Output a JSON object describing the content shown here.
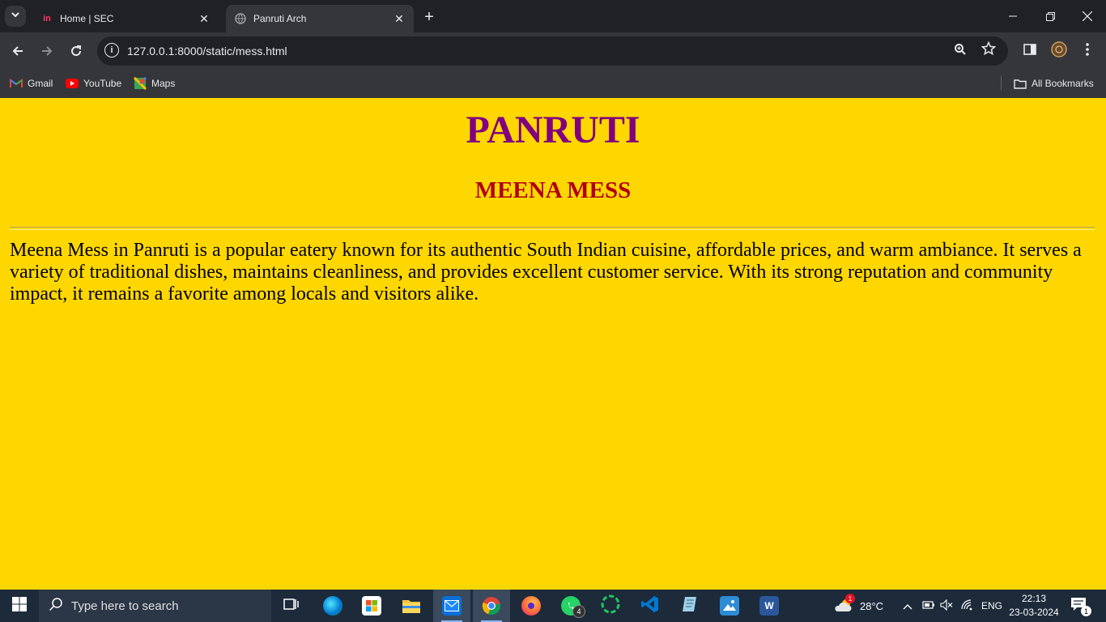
{
  "browser": {
    "tabs": [
      {
        "title": "Home | SEC",
        "favicon": "invision-icon"
      },
      {
        "title": "Panruti Arch",
        "favicon": "globe-icon"
      }
    ],
    "url": "127.0.0.1:8000/static/mess.html",
    "bookmarks": [
      {
        "label": "Gmail",
        "icon": "gmail-icon"
      },
      {
        "label": "YouTube",
        "icon": "youtube-icon"
      },
      {
        "label": "Maps",
        "icon": "maps-icon"
      }
    ],
    "all_bookmarks_label": "All Bookmarks"
  },
  "page": {
    "heading": "PANRUTI",
    "subheading": "MEENA MESS",
    "paragraph": "Meena Mess in Panruti is a popular eatery known for its authentic South Indian cuisine, affordable prices, and warm ambiance. It serves a variety of traditional dishes, maintains cleanliness, and provides excellent customer service. With its strong reputation and community impact, it remains a favorite among locals and visitors alike.",
    "background_color": "#ffd700",
    "heading_color": "#800080",
    "subheading_color": "#b00010"
  },
  "taskbar": {
    "search_placeholder": "Type here to search",
    "whatsapp_badge": "4",
    "weather_temp": "28°C",
    "weather_badge": "1",
    "language": "ENG",
    "time": "22:13",
    "date": "23-03-2024",
    "notification_count": "1"
  }
}
